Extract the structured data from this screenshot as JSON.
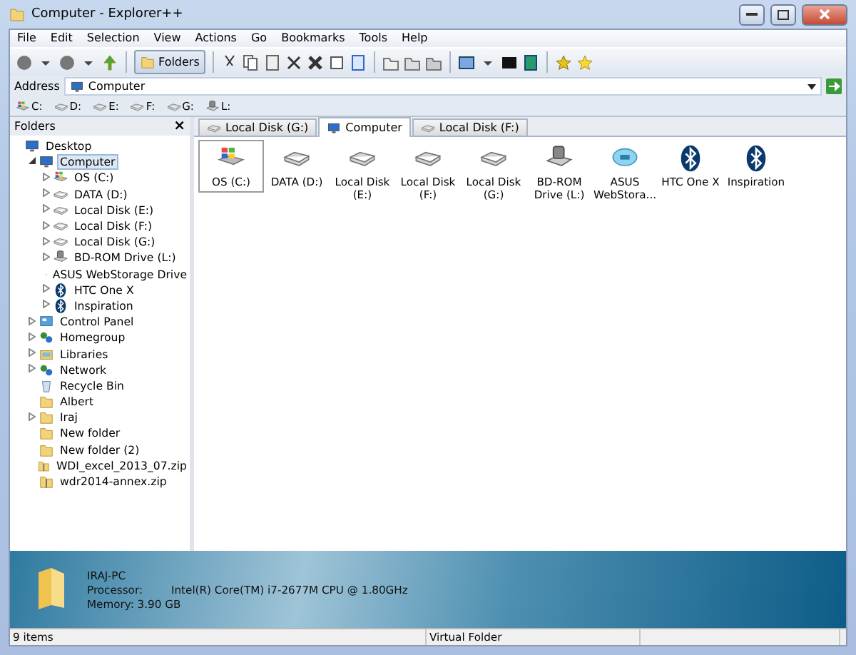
{
  "window": {
    "title": "Computer - Explorer++"
  },
  "menu": [
    "File",
    "Edit",
    "Selection",
    "View",
    "Actions",
    "Go",
    "Bookmarks",
    "Tools",
    "Help"
  ],
  "toolbar": {
    "folders_button": {
      "label": "Folders",
      "selected": true
    }
  },
  "address": {
    "label": "Address",
    "value": "Computer"
  },
  "drives": [
    {
      "label": "C:",
      "kind": "system"
    },
    {
      "label": "D:",
      "kind": "disk"
    },
    {
      "label": "E:",
      "kind": "disk"
    },
    {
      "label": "F:",
      "kind": "disk"
    },
    {
      "label": "G:",
      "kind": "disk"
    },
    {
      "label": "L:",
      "kind": "optical"
    }
  ],
  "folders_pane": {
    "title": "Folders",
    "close": "×",
    "tree": [
      {
        "label": "Desktop",
        "kind": "desktop",
        "selected": false,
        "children": [
          {
            "label": "Computer",
            "kind": "computer",
            "expandable": true,
            "expanded": true,
            "selected": true,
            "children": [
              {
                "label": "OS (C:)",
                "kind": "system",
                "expandable": true,
                "expanded": false,
                "selected": false
              },
              {
                "label": "DATA (D:)",
                "kind": "disk",
                "expandable": true,
                "expanded": false,
                "selected": false
              },
              {
                "label": "Local Disk (E:)",
                "kind": "disk",
                "expandable": true,
                "expanded": false,
                "selected": false
              },
              {
                "label": "Local Disk (F:)",
                "kind": "disk",
                "expandable": true,
                "expanded": false,
                "selected": false
              },
              {
                "label": "Local Disk (G:)",
                "kind": "disk",
                "expandable": true,
                "expanded": false,
                "selected": false
              },
              {
                "label": "BD-ROM Drive (L:)",
                "kind": "optical",
                "expandable": true,
                "expanded": false,
                "selected": false
              },
              {
                "label": "ASUS WebStorage Drive",
                "kind": "cloud",
                "expandable": false,
                "expanded": false,
                "selected": false
              },
              {
                "label": "HTC One X",
                "kind": "bluetooth",
                "expandable": true,
                "expanded": false,
                "selected": false
              },
              {
                "label": "Inspiration",
                "kind": "bluetooth",
                "expandable": true,
                "expanded": false,
                "selected": false
              }
            ]
          },
          {
            "label": "Control Panel",
            "kind": "panel",
            "expandable": true,
            "expanded": false,
            "selected": false
          },
          {
            "label": "Homegroup",
            "kind": "network",
            "expandable": true,
            "expanded": false,
            "selected": false
          },
          {
            "label": "Libraries",
            "kind": "library",
            "expandable": true,
            "expanded": false,
            "selected": false
          },
          {
            "label": "Network",
            "kind": "network",
            "expandable": true,
            "expanded": false,
            "selected": false
          },
          {
            "label": "Recycle Bin",
            "kind": "bin",
            "expandable": false,
            "expanded": false,
            "selected": false
          },
          {
            "label": "Albert",
            "kind": "folder",
            "expandable": false,
            "expanded": false,
            "selected": false
          },
          {
            "label": "Iraj",
            "kind": "folder",
            "expandable": true,
            "expanded": false,
            "selected": false
          },
          {
            "label": "New folder",
            "kind": "folder",
            "expandable": false,
            "expanded": false,
            "selected": false
          },
          {
            "label": "New folder (2)",
            "kind": "folder",
            "expandable": false,
            "expanded": false,
            "selected": false
          },
          {
            "label": "WDI_excel_2013_07.zip",
            "kind": "zip",
            "expandable": false,
            "expanded": false,
            "selected": false
          },
          {
            "label": "wdr2014-annex.zip",
            "kind": "zip",
            "expandable": false,
            "expanded": false,
            "selected": false
          }
        ]
      }
    ]
  },
  "tabs": [
    {
      "label": "Local Disk (G:)",
      "kind": "disk",
      "selected": false
    },
    {
      "label": "Computer",
      "kind": "computer",
      "selected": true
    },
    {
      "label": "Local Disk (F:)",
      "kind": "disk",
      "selected": false
    }
  ],
  "items": [
    {
      "label": "OS (C:)",
      "kind": "system",
      "selected": true
    },
    {
      "label": "DATA (D:)",
      "kind": "disk",
      "selected": false
    },
    {
      "label": "Local Disk (E:)",
      "kind": "disk",
      "selected": false
    },
    {
      "label": "Local Disk (F:)",
      "kind": "disk",
      "selected": false
    },
    {
      "label": "Local Disk (G:)",
      "kind": "disk",
      "selected": false
    },
    {
      "label": "BD-ROM Drive (L:)",
      "kind": "optical",
      "selected": false
    },
    {
      "label": "ASUS WebStora...",
      "kind": "cloud",
      "selected": false
    },
    {
      "label": "HTC One X",
      "kind": "bluetooth",
      "selected": false
    },
    {
      "label": "Inspiration",
      "kind": "bluetooth",
      "selected": false
    }
  ],
  "info": {
    "name": "IRAJ-PC",
    "processor_label": "Processor:",
    "processor": "Intel(R) Core(TM) i7-2677M CPU @ 1.80GHz",
    "memory": "Memory: 3.90 GB"
  },
  "status_bar": {
    "count": "9 items",
    "type": "Virtual Folder"
  }
}
